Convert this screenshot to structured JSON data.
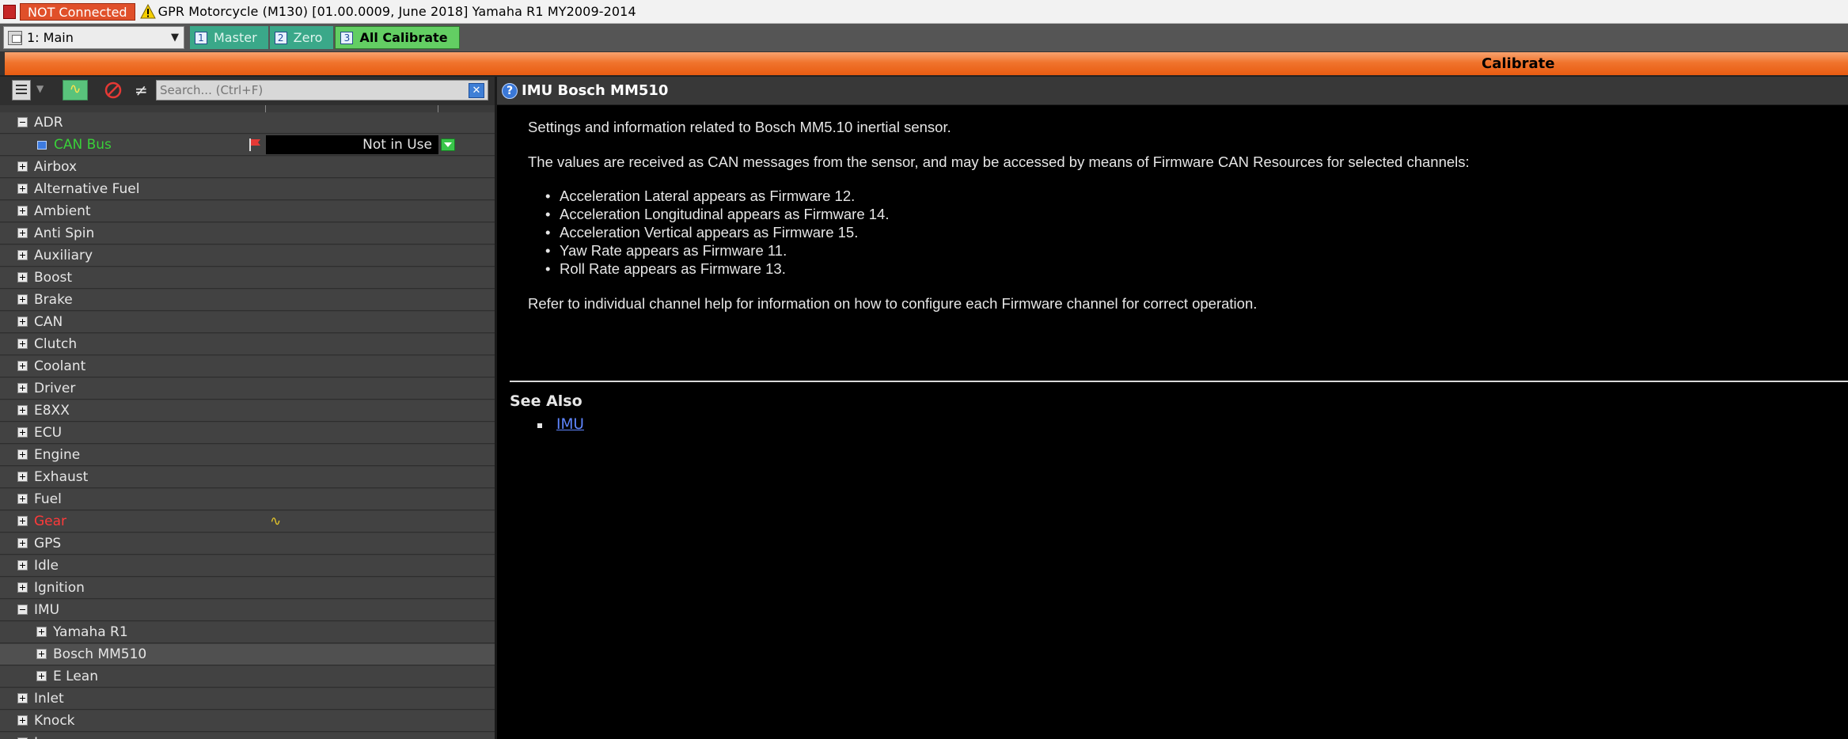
{
  "titlebar": {
    "status": "NOT Connected",
    "title": "GPR Motorcycle (M130) [01.00.0009, June 2018] Yamaha R1 MY2009-2014"
  },
  "toolbar": {
    "workbook": "1: Main",
    "tabs": [
      {
        "num": "1",
        "label": "Master"
      },
      {
        "num": "2",
        "label": "Zero"
      },
      {
        "num": "3",
        "label": "All Calibrate"
      }
    ]
  },
  "calbar": {
    "label": "Calibrate"
  },
  "search": {
    "placeholder": "Search... (Ctrl+F)"
  },
  "tree": {
    "adr": "ADR",
    "can_bus": {
      "label": "CAN Bus",
      "value": "Not in Use"
    },
    "items_a": [
      "Airbox",
      "Alternative Fuel",
      "Ambient",
      "Anti Spin",
      "Auxiliary",
      "Boost",
      "Brake",
      "CAN",
      "Clutch",
      "Coolant",
      "Driver",
      "E8XX",
      "ECU",
      "Engine",
      "Exhaust",
      "Fuel"
    ],
    "gear": "Gear",
    "items_b": [
      "GPS",
      "Idle",
      "Ignition"
    ],
    "imu": "IMU",
    "imu_children": [
      "Yamaha R1",
      "Bosch MM510",
      "E Lean"
    ],
    "items_c": [
      "Inlet",
      "Knock",
      "Lap"
    ]
  },
  "help": {
    "title": "IMU Bosch MM510",
    "p1": "Settings and information related to Bosch MM5.10 inertial sensor.",
    "p2": "The values are received as CAN messages from the sensor, and may be accessed by means of Firmware CAN Resources for selected channels:",
    "bullets": [
      "Acceleration Lateral appears as Firmware 12.",
      "Acceleration Longitudinal appears as Firmware 14.",
      "Acceleration Vertical appears as Firmware 15.",
      "Yaw Rate appears as Firmware 11.",
      "Roll Rate appears as Firmware 13."
    ],
    "p3": "Refer to individual channel help for information on how to configure each Firmware channel for correct operation.",
    "see_also": "See Also",
    "link": "IMU"
  },
  "colors": {
    "accent_orange": "#f0742d",
    "tab_teal": "#3aa889",
    "tab_active": "#63ce63",
    "gear_red": "#ff3a3a",
    "canbus_green": "#39d039"
  }
}
